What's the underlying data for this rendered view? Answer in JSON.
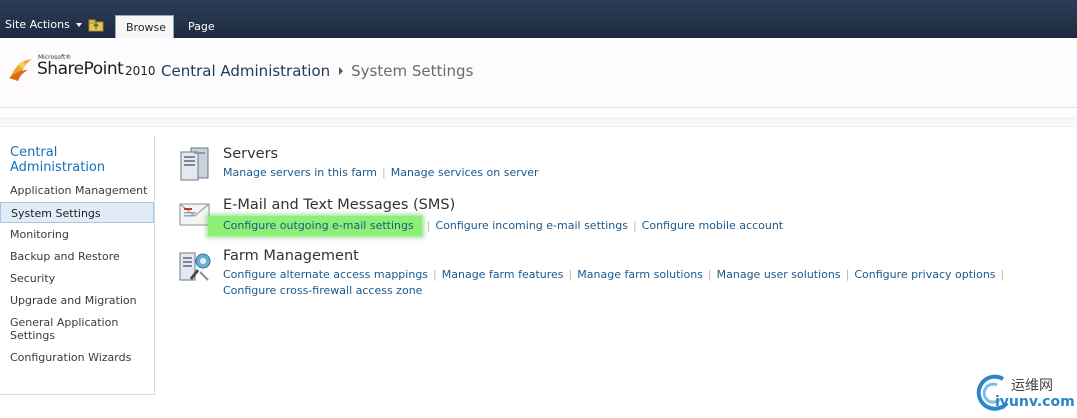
{
  "ribbon": {
    "site_actions_label": "Site Actions",
    "tabs": [
      {
        "label": "Browse",
        "selected": true
      },
      {
        "label": "Page",
        "selected": false
      }
    ]
  },
  "header": {
    "logo": {
      "microsoft": "Microsoft®",
      "product": "SharePoint",
      "year": "2010"
    },
    "breadcrumb": [
      {
        "label": "Central Administration",
        "link": true
      },
      {
        "label": "System Settings",
        "link": false
      }
    ]
  },
  "left_nav": {
    "heading": "Central Administration",
    "items": [
      {
        "label": "Application Management",
        "selected": false
      },
      {
        "label": "System Settings",
        "selected": true
      },
      {
        "label": "Monitoring",
        "selected": false
      },
      {
        "label": "Backup and Restore",
        "selected": false
      },
      {
        "label": "Security",
        "selected": false
      },
      {
        "label": "Upgrade and Migration",
        "selected": false
      },
      {
        "label": "General Application Settings",
        "selected": false
      },
      {
        "label": "Configuration Wizards",
        "selected": false
      }
    ]
  },
  "sections": [
    {
      "title": "Servers",
      "icon": "server-icon",
      "links": [
        "Manage servers in this farm",
        "Manage services on server"
      ]
    },
    {
      "title": "E-Mail and Text Messages (SMS)",
      "icon": "email-icon",
      "links": [
        "Configure outgoing e-mail settings",
        "Configure incoming e-mail settings",
        "Configure mobile account"
      ],
      "highlighted_link": "Configure outgoing e-mail settings"
    },
    {
      "title": "Farm Management",
      "icon": "farm-management-icon",
      "links": [
        "Configure alternate access mappings",
        "Manage farm features",
        "Manage farm solutions",
        "Manage user solutions",
        "Configure privacy options",
        "Configure cross-firewall access zone"
      ]
    }
  ],
  "watermark": {
    "chinese": "运维网",
    "url": "iyunv.com"
  },
  "colors": {
    "ribbon_bg": "#1d2b40",
    "link": "#1a5a8e",
    "nav_heading": "#1870b8",
    "selected_nav_bg": "#e1ecf7",
    "highlight": "#8bf075"
  }
}
